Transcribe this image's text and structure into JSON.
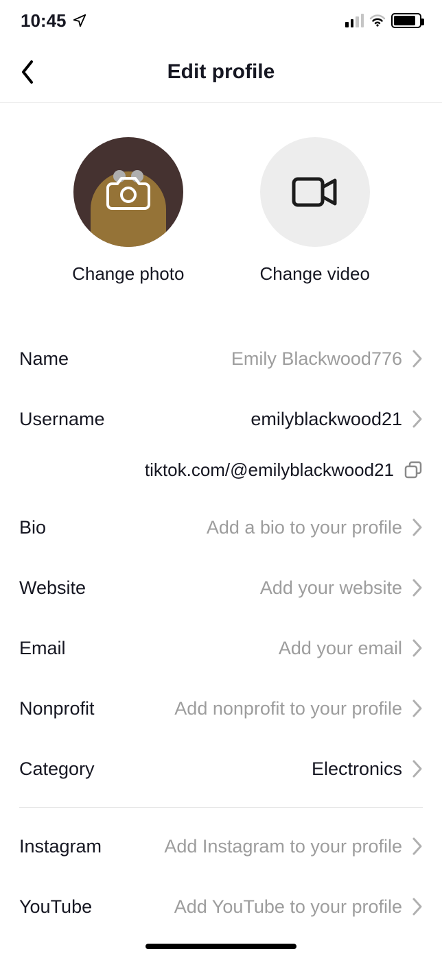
{
  "status": {
    "time": "10:45"
  },
  "header": {
    "title": "Edit profile"
  },
  "media": {
    "photo_label": "Change photo",
    "video_label": "Change video"
  },
  "profile_url": "tiktok.com/@emilyblackwood21",
  "fields": {
    "name": {
      "label": "Name",
      "value": "Emily Blackwood776",
      "placeholder": false
    },
    "username": {
      "label": "Username",
      "value": "emilyblackwood21",
      "placeholder": false
    },
    "bio": {
      "label": "Bio",
      "value": "Add a bio to your profile",
      "placeholder": true
    },
    "website": {
      "label": "Website",
      "value": "Add your website",
      "placeholder": true
    },
    "email": {
      "label": "Email",
      "value": "Add your email",
      "placeholder": true
    },
    "nonprofit": {
      "label": "Nonprofit",
      "value": "Add nonprofit to your profile",
      "placeholder": true
    },
    "category": {
      "label": "Category",
      "value": "Electronics",
      "placeholder": false
    },
    "instagram": {
      "label": "Instagram",
      "value": "Add Instagram to your profile",
      "placeholder": true
    },
    "youtube": {
      "label": "YouTube",
      "value": "Add YouTube to your profile",
      "placeholder": true
    }
  }
}
